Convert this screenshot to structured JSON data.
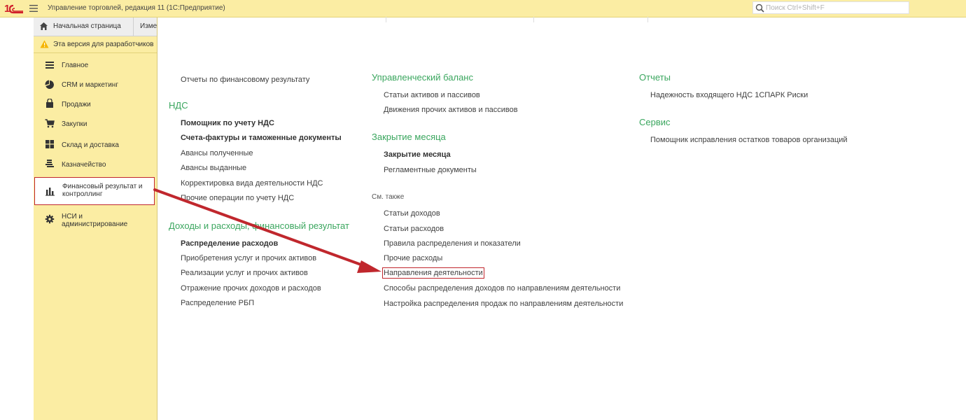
{
  "titlebar": {
    "title": "Управление торговлей, редакция 11  (1С:Предприятие)",
    "search_placeholder": "Поиск Ctrl+Shift+F"
  },
  "tabs": {
    "home": "Начальная страница",
    "second": "Изменения"
  },
  "warning": "Эта версия для разработчиков",
  "sections": [
    {
      "label": "Главное",
      "icon": "menu-icon"
    },
    {
      "label": "CRM и маркетинг",
      "icon": "pie-chart-icon"
    },
    {
      "label": "Продажи",
      "icon": "shopping-bag-icon"
    },
    {
      "label": "Закупки",
      "icon": "cart-icon"
    },
    {
      "label": "Склад и доставка",
      "icon": "warehouse-icon"
    },
    {
      "label": "Казначейство",
      "icon": "treasury-icon"
    },
    {
      "label_line1": "Финансовый результат и",
      "label_line2": "контроллинг",
      "icon": "bar-chart-icon",
      "active": true
    },
    {
      "label_line1": "НСИ и",
      "label_line2": "администрирование",
      "icon": "gear-icon"
    }
  ],
  "col1": {
    "top_item": "Отчеты по финансовому результату",
    "vat_header": "НДС",
    "vat_items": [
      "Помощник по учету НДС",
      "Счета-фактуры и таможенные документы",
      "Авансы полученные",
      "Авансы выданные",
      "Корректировка вида деятельности НДС",
      "Прочие операции по учету НДС"
    ],
    "income_header": "Доходы и расходы, финансовый результат",
    "income_items": [
      "Распределение расходов",
      "Приобретения услуг и прочих активов",
      "Реализации услуг и прочих активов",
      "Отражение прочих доходов и расходов",
      "Распределение РБП"
    ]
  },
  "col2": {
    "balance_header": "Управленческий баланс",
    "balance_items": [
      "Статьи активов и пассивов",
      "Движения прочих активов и пассивов"
    ],
    "close_header": "Закрытие месяца",
    "close_items": [
      "Закрытие месяца",
      "Регламентные документы"
    ],
    "see_also_header": "См. также",
    "see_also_items": [
      "Статьи доходов",
      "Статьи расходов",
      "Правила распределения и показатели",
      "Прочие расходы",
      "Направления деятельности",
      "Способы распределения доходов по направлениям деятельности",
      "Настройка распределения продаж по направлениям деятельности"
    ]
  },
  "col3": {
    "reports_header": "Отчеты",
    "reports_items": [
      "Надежность входящего НДС 1СПАРК Риски"
    ],
    "service_header": "Сервис",
    "service_items": [
      "Помощник исправления остатков товаров организаций"
    ]
  },
  "colors": {
    "panel": "#fbeda3",
    "header_green": "#3aa65e",
    "annotation_red": "#c0272d"
  }
}
